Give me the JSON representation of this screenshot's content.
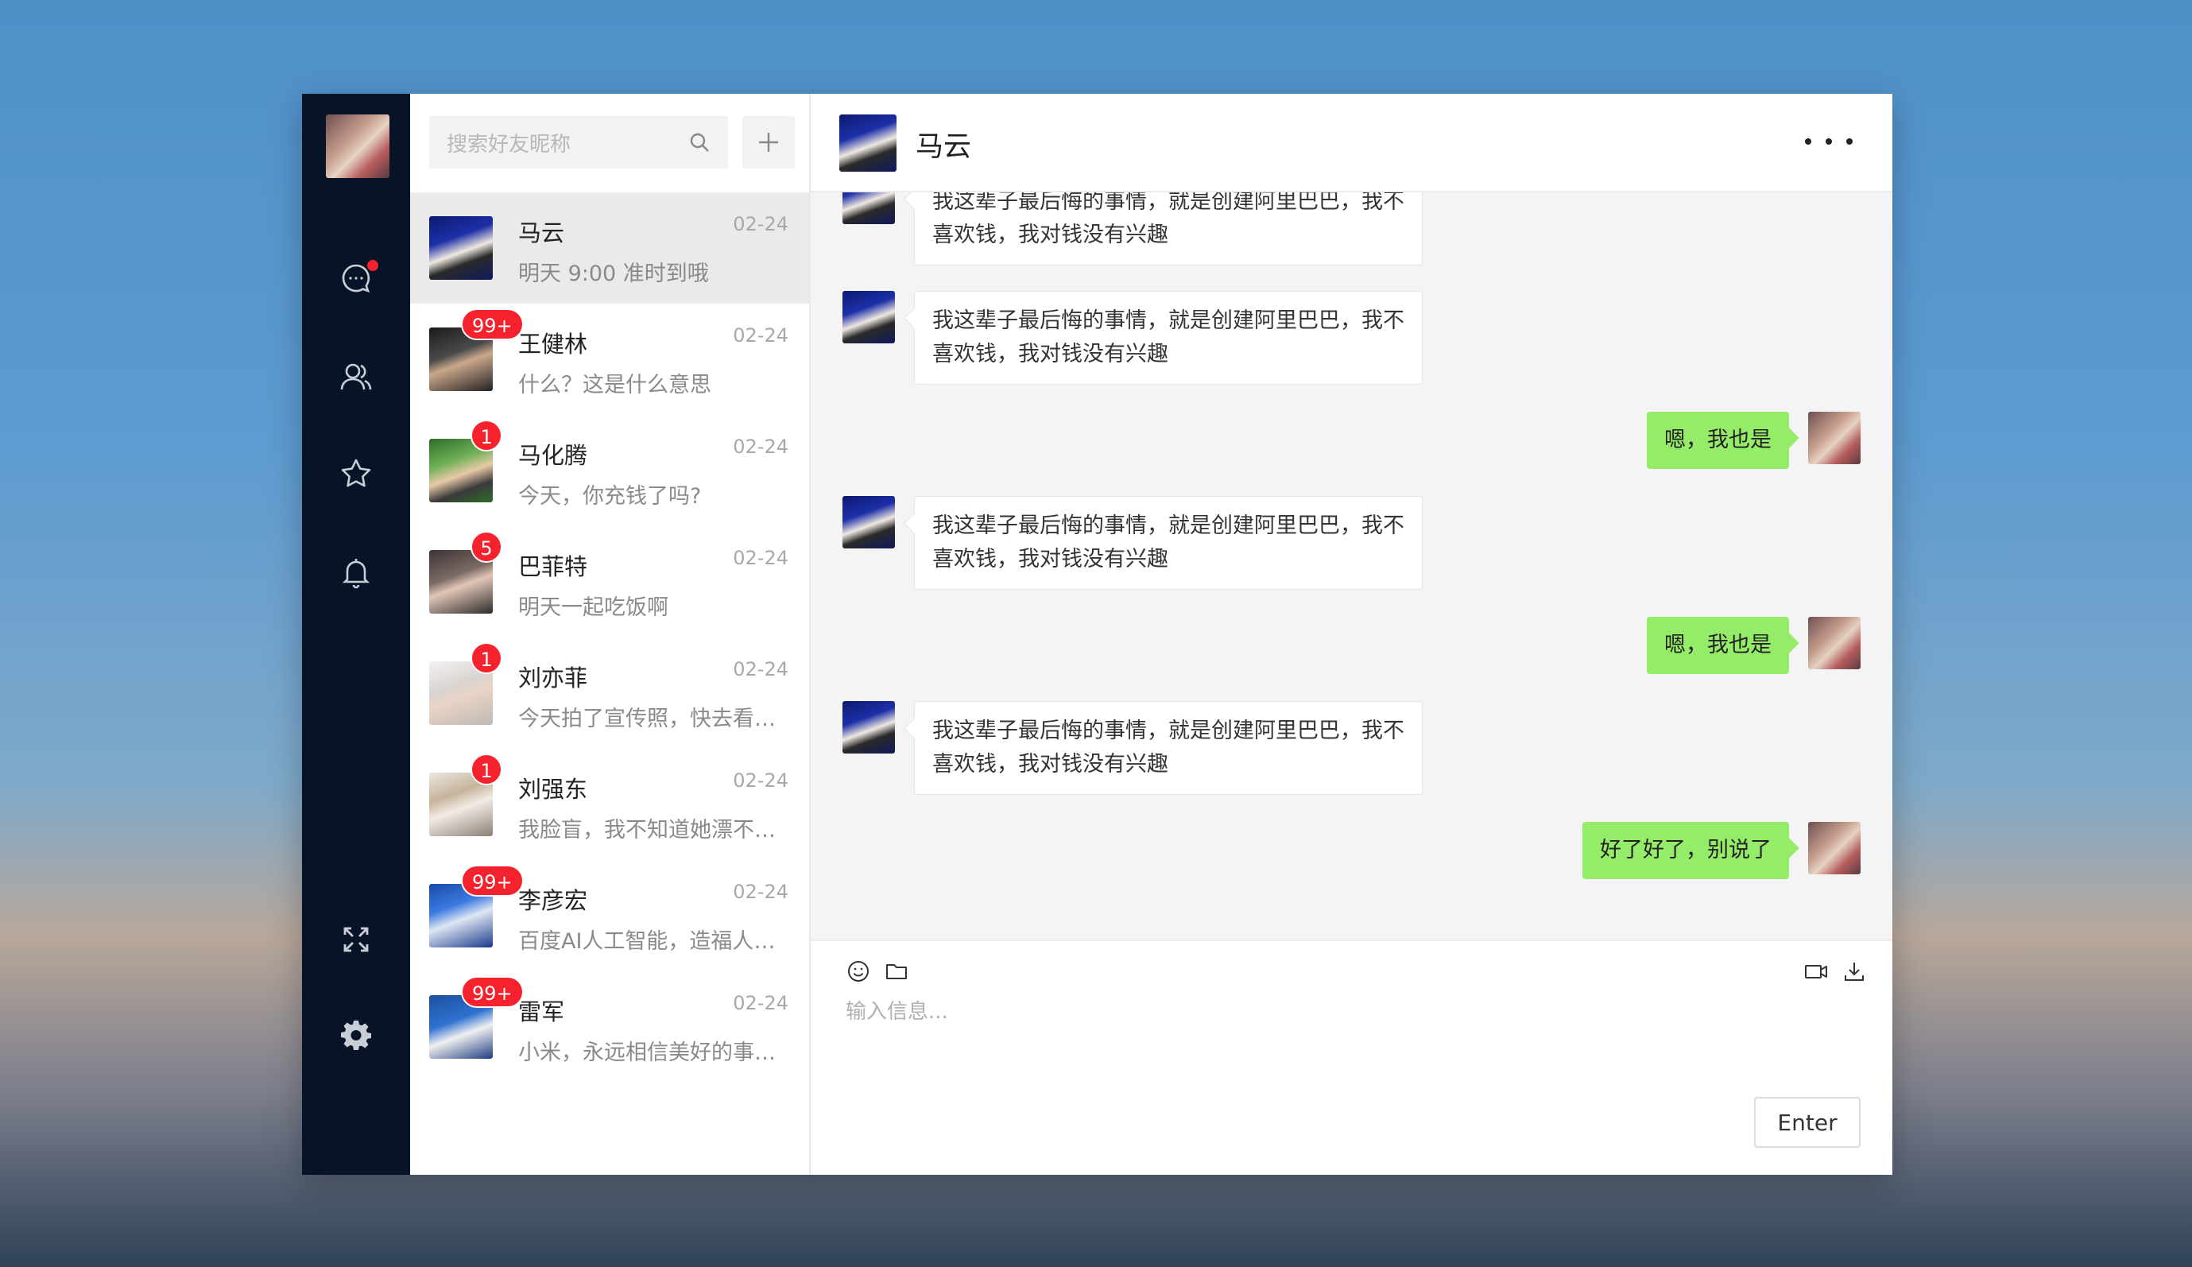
{
  "search": {
    "placeholder": "搜索好友昵称"
  },
  "contacts": [
    {
      "name": "马云",
      "date": "02-24",
      "message": "明天 9:00 准时到哦",
      "badge": ""
    },
    {
      "name": "王健林",
      "date": "02-24",
      "message": "什么？这是什么意思",
      "badge": "99+"
    },
    {
      "name": "马化腾",
      "date": "02-24",
      "message": "今天，你充钱了吗?",
      "badge": "1"
    },
    {
      "name": "巴菲特",
      "date": "02-24",
      "message": "明天一起吃饭啊",
      "badge": "5"
    },
    {
      "name": "刘亦菲",
      "date": "02-24",
      "message": "今天拍了宣传照，快去看看吧",
      "badge": "1"
    },
    {
      "name": "刘强东",
      "date": "02-24",
      "message": "我脸盲，我不知道她漂不漂亮",
      "badge": "1"
    },
    {
      "name": "李彦宏",
      "date": "02-24",
      "message": "百度AI人工智能，造福人类社会",
      "badge": "99+"
    },
    {
      "name": "雷军",
      "date": "02-24",
      "message": "小米，永远相信美好的事情即将发生",
      "badge": "99+"
    }
  ],
  "chat": {
    "title": "马云",
    "messages": [
      {
        "from": "other",
        "text": "我这辈子最后悔的事情，就是创建阿里巴巴，我不喜欢钱，我对钱没有兴趣"
      },
      {
        "from": "other",
        "text": "我这辈子最后悔的事情，就是创建阿里巴巴，我不喜欢钱，我对钱没有兴趣"
      },
      {
        "from": "me",
        "text": "嗯，我也是"
      },
      {
        "from": "other",
        "text": "我这辈子最后悔的事情，就是创建阿里巴巴，我不喜欢钱，我对钱没有兴趣"
      },
      {
        "from": "me",
        "text": "嗯，我也是"
      },
      {
        "from": "other",
        "text": "我这辈子最后悔的事情，就是创建阿里巴巴，我不喜欢钱，我对钱没有兴趣"
      },
      {
        "from": "me",
        "text": "好了好了，别说了"
      }
    ],
    "input_placeholder": "输入信息...",
    "send_label": "Enter"
  },
  "nav": {
    "icons": [
      "chat-icon",
      "contacts-icon",
      "favorites-icon",
      "notifications-icon",
      "fullscreen-icon",
      "settings-icon"
    ],
    "unread_dot_color": "#f5222d"
  },
  "colors": {
    "sidebar": "#071427",
    "outgoing_bubble": "#95ec69",
    "badge": "#f5222d"
  }
}
